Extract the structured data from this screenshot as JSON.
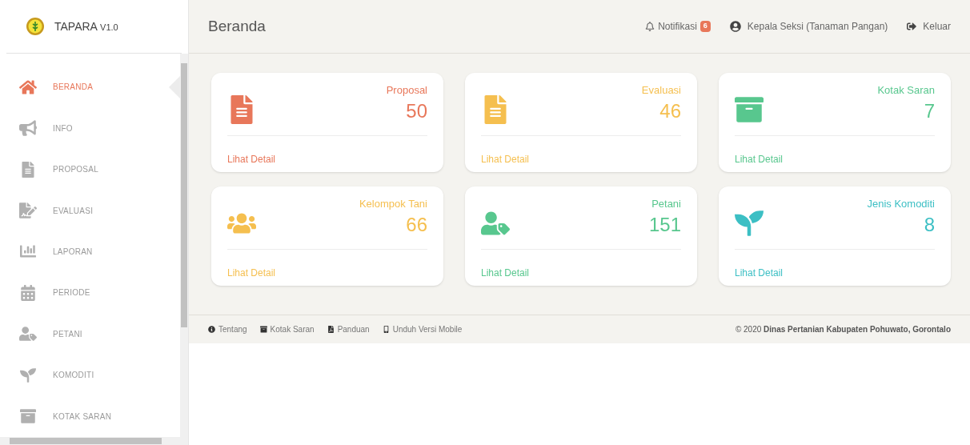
{
  "brand": {
    "name": "TAPARA",
    "version": "V1.0"
  },
  "sidebar": {
    "items": [
      {
        "label": "BERANDA",
        "selected": true
      },
      {
        "label": "INFO",
        "selected": false
      },
      {
        "label": "PROPOSAL",
        "selected": false
      },
      {
        "label": "EVALUASI",
        "selected": false
      },
      {
        "label": "LAPORAN",
        "selected": false
      },
      {
        "label": "PERIODE",
        "selected": false
      },
      {
        "label": "PETANI",
        "selected": false
      },
      {
        "label": "KOMODITI",
        "selected": false
      },
      {
        "label": "KOTAK SARAN",
        "selected": false
      }
    ]
  },
  "header": {
    "title": "Beranda",
    "notifications": {
      "label": "Notifikasi",
      "count": "6"
    },
    "user": "Kepala Seksi (Tanaman Pangan)",
    "logout": "Keluar"
  },
  "cards": [
    {
      "kind": "document",
      "title": "Proposal",
      "value": "50",
      "link": "Lihat Detail",
      "color": "#e8775a"
    },
    {
      "kind": "document",
      "title": "Evaluasi",
      "value": "46",
      "link": "Lihat Detail",
      "color": "#f5bf4f"
    },
    {
      "kind": "box",
      "title": "Kotak Saran",
      "value": "7",
      "link": "Lihat Detail",
      "color": "#58c78e"
    },
    {
      "kind": "group",
      "title": "Kelompok Tani",
      "value": "66",
      "link": "Lihat Detail",
      "color": "#f5bf4f"
    },
    {
      "kind": "user-tag",
      "title": "Petani",
      "value": "151",
      "link": "Lihat Detail",
      "color": "#58c78e"
    },
    {
      "kind": "plant",
      "title": "Jenis Komoditi",
      "value": "8",
      "link": "Lihat Detail",
      "color": "#3cbfc4"
    }
  ],
  "footer": {
    "links": [
      {
        "kind": "info",
        "label": "Tentang"
      },
      {
        "kind": "box",
        "label": "Kotak Saran"
      },
      {
        "kind": "pdf",
        "label": "Panduan"
      },
      {
        "kind": "mobile",
        "label": "Unduh Versi Mobile"
      }
    ],
    "copyright": "© 2020 **Dinas Pertanian Kabupaten Pohuwato, Gorontalo**"
  }
}
